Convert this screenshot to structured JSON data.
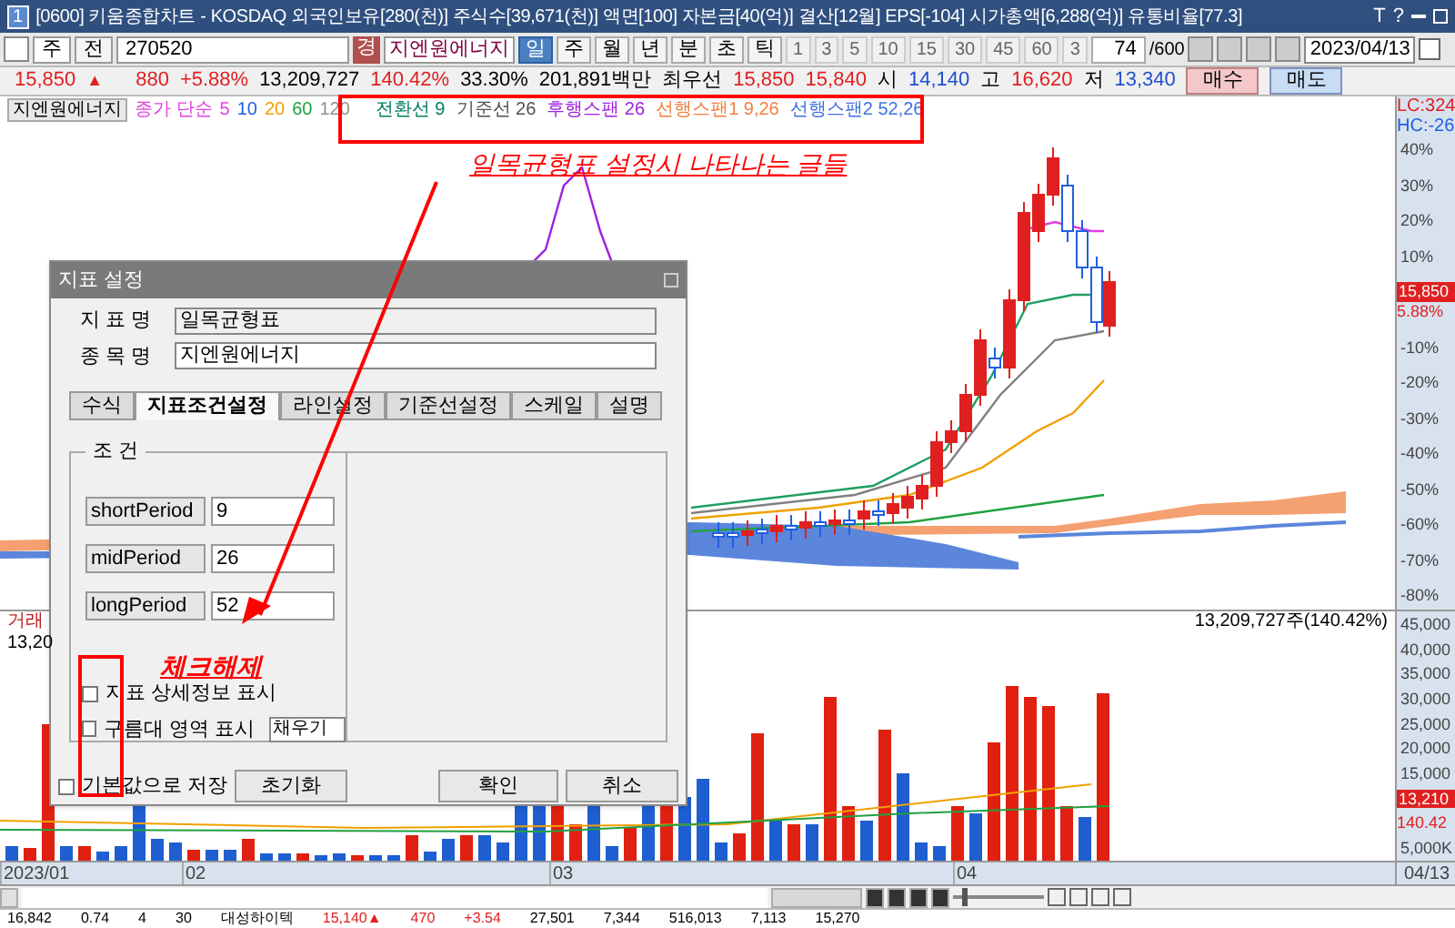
{
  "title_bar": {
    "badge": "1",
    "title": "[0600] 키움종합차트 - KOSDAQ 외국인보유[280(천)] 주식수[39,671(천)] 액면[100] 자본금[40(억)] 결산[12월] EPS[-104] 시가총액[6,288(억)] 유통비율[77.3]",
    "controls": [
      "T",
      "?"
    ]
  },
  "toolbar": {
    "period_type": "주",
    "mode": "전",
    "code": "270520",
    "tag": "경",
    "stock_name": "지엔원에너지",
    "periods": [
      {
        "label": "일",
        "selected": true
      },
      {
        "label": "주",
        "selected": false
      },
      {
        "label": "월",
        "selected": false
      },
      {
        "label": "년",
        "selected": false
      },
      {
        "label": "분",
        "selected": false
      },
      {
        "label": "초",
        "selected": false
      },
      {
        "label": "틱",
        "selected": false
      }
    ],
    "intervals": [
      "1",
      "3",
      "5",
      "10",
      "15",
      "30",
      "45",
      "60"
    ],
    "interval_value": "3",
    "bar_count": "74",
    "bar_total": "/600",
    "date": "2023/04/13",
    "zoom": {
      "level": 0.1
    }
  },
  "quote": {
    "price": "15,850",
    "arrow": "▲",
    "change": "880",
    "rate": "+5.88%",
    "volume": "13,209,727",
    "volume_rate": "140.42%",
    "turnover": "33.30%",
    "amount": "201,891백만",
    "best_label": "최우선",
    "ask": "15,850",
    "bid": "15,840",
    "ohl": [
      {
        "label": "시",
        "value": "14,140"
      },
      {
        "label": "고",
        "value": "16,620"
      },
      {
        "label": "저",
        "value": "13,340"
      }
    ],
    "buttons": [
      {
        "label": "매수",
        "kind": "buy"
      },
      {
        "label": "매도",
        "kind": "sell"
      }
    ]
  },
  "legend": {
    "stock": "지엔원에너지",
    "ma_label": "종가 단순",
    "ma_periods": [
      {
        "label": "5",
        "color": "#e040e0"
      },
      {
        "label": "10",
        "color": "#2060e0"
      },
      {
        "label": "20",
        "color": "#f0a000"
      },
      {
        "label": "60",
        "color": "#20a040"
      },
      {
        "label": "120",
        "color": "#909090"
      }
    ],
    "ichimoku": [
      {
        "label": "전환선 9",
        "color": "#008060"
      },
      {
        "label": "기준선 26",
        "color": "#505050"
      },
      {
        "label": "후행스팬 26",
        "color": "#a020e0"
      },
      {
        "label": "선행스팬1 9,26",
        "color": "#f08040"
      },
      {
        "label": "선행스팬2 52,26",
        "color": "#4070e0"
      }
    ]
  },
  "price_axis": {
    "header": [
      "LC:324",
      "HC:-26"
    ],
    "ticks": [
      "40%",
      "30%",
      "20%",
      "10%",
      "-10%",
      "-20%",
      "-30%",
      "-40%",
      "-50%",
      "-60%",
      "-70%",
      "-80%"
    ],
    "price_tag": "15,850",
    "rate_tag": "5.88%"
  },
  "volume_pane": {
    "title": "거래",
    "left_value": "13,20",
    "header": "13,209,727주(140.42%)",
    "ticks": [
      "45,000",
      "40,000",
      "35,000",
      "30,000",
      "25,000",
      "20,000",
      "15,000",
      "5,000K"
    ],
    "value_tag": "13,210",
    "rate_tag": "140.42"
  },
  "date_axis": {
    "labels": [
      "2023/01",
      "02",
      "03",
      "04"
    ],
    "current": "04/13"
  },
  "dialog": {
    "title": "지표 설정",
    "name_label": "지 표 명",
    "name_value": "일목균형표",
    "stock_label": "종 목 명",
    "stock_value": "지엔원에너지",
    "tabs": [
      {
        "label": "수식",
        "selected": false
      },
      {
        "label": "지표조건설정",
        "selected": true
      },
      {
        "label": "라인설정",
        "selected": false
      },
      {
        "label": "기준선설정",
        "selected": false
      },
      {
        "label": "스케일",
        "selected": false
      },
      {
        "label": "설명",
        "selected": false
      }
    ],
    "group": "조 건",
    "params": [
      {
        "label": "shortPeriod",
        "value": "9"
      },
      {
        "label": "midPeriod",
        "value": "26"
      },
      {
        "label": "longPeriod",
        "value": "52"
      }
    ],
    "options": [
      {
        "label": "지표 상세정보 표시",
        "checked": false
      },
      {
        "label": "구름대 영역 표시",
        "checked": false
      }
    ],
    "fill_select": "채우기",
    "save_default": {
      "label": "기본값으로 저장",
      "checked": false
    },
    "buttons": [
      "초기화",
      "확인",
      "취소"
    ]
  },
  "annotations": {
    "legend_note": "일목균형표 설정시 나타나는 글들",
    "check_note": "체크해제"
  },
  "bottom_row": [
    "16,842",
    "0.74",
    "4",
    "30",
    "대성하이텍",
    "15,140▲",
    "470",
    "+3.54",
    "27,501",
    "7,344",
    "516,013",
    "7,113",
    "15,270"
  ]
}
